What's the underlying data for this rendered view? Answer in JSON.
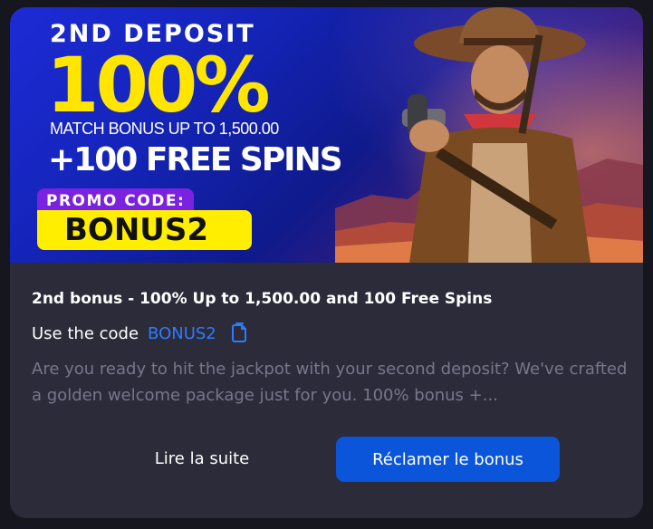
{
  "banner": {
    "title": "2ND DEPOSIT",
    "percent": "100%",
    "match": "MATCH BONUS UP TO 1,500.00",
    "spins": "+100 FREE SPINS",
    "promo_label": "PROMO CODE:",
    "promo_code": "BONUS2"
  },
  "offer": {
    "title": "2nd bonus - 100% Up to 1,500.00 and 100 Free Spins",
    "code_label": "Use the code",
    "code_value": "BONUS2",
    "description": "Are you ready to hit the jackpot with your second deposit? We've crafted a golden welcome package just for you. 100% bonus +..."
  },
  "actions": {
    "read_more": "Lire la suite",
    "claim": "Réclamer le bonus"
  },
  "colors": {
    "accent_blue": "#0a55d9",
    "code_blue": "#2f7bff",
    "promo_yellow": "#ffee00",
    "headline_yellow": "#ffe500",
    "promo_purple": "#7a22e0"
  },
  "icons": {
    "copy": "copy-icon"
  }
}
